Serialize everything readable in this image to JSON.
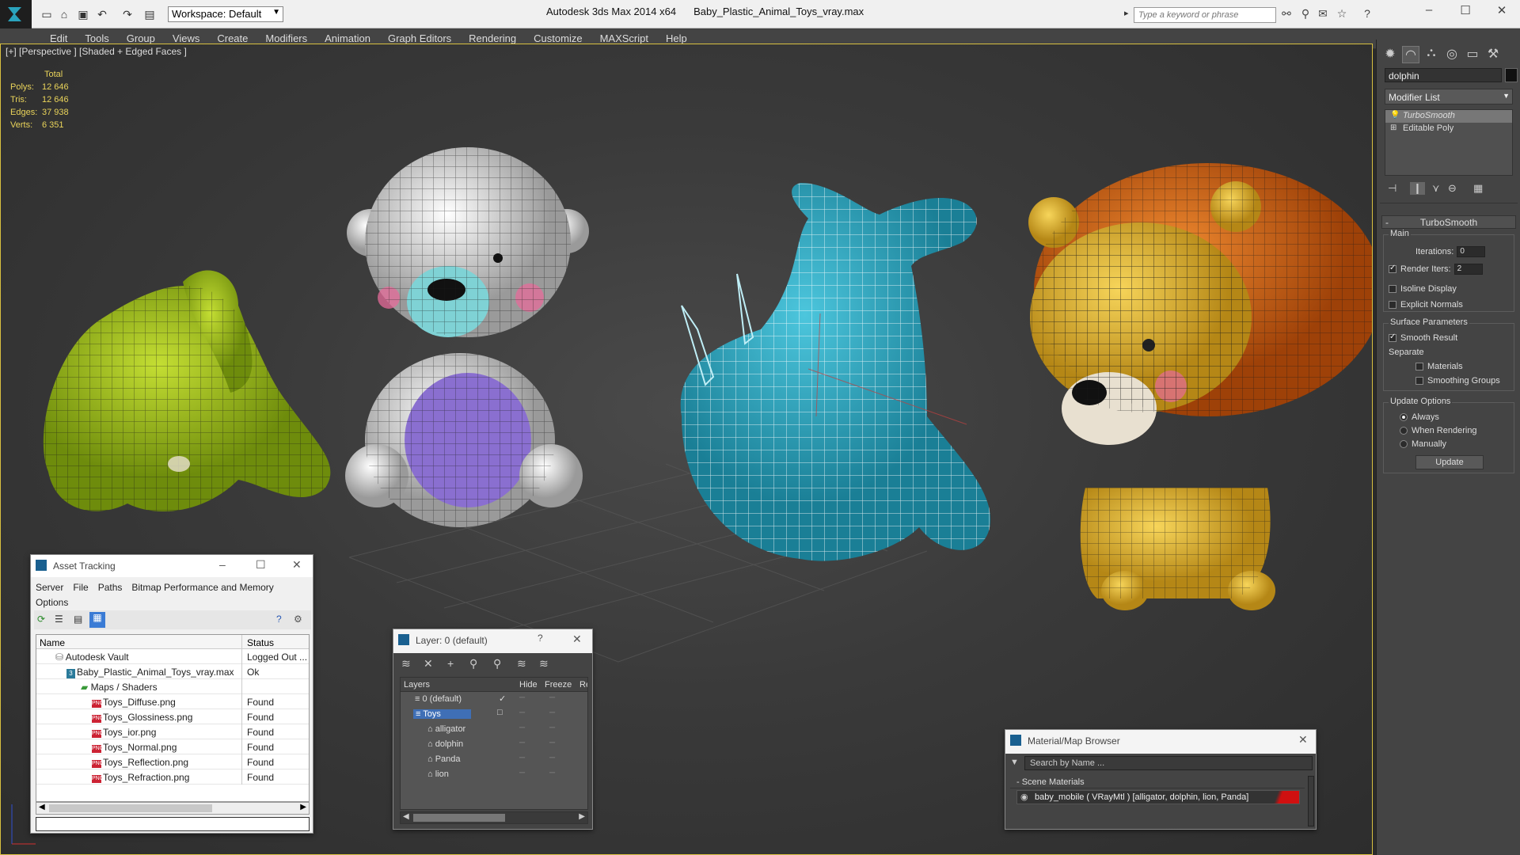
{
  "titlebar": {
    "workspace": "Workspace: Default",
    "app_title": "Autodesk 3ds Max  2014 x64",
    "file_name": "Baby_Plastic_Animal_Toys_vray.max",
    "search_placeholder": "Type a keyword or phrase"
  },
  "menu": [
    "Edit",
    "Tools",
    "Group",
    "Views",
    "Create",
    "Modifiers",
    "Animation",
    "Graph Editors",
    "Rendering",
    "Customize",
    "MAXScript",
    "Help"
  ],
  "viewport": {
    "label": "[+] [Perspective ] [Shaded + Edged Faces ]",
    "stats_header": "Total",
    "stats": [
      {
        "label": "Polys:",
        "value": "12 646"
      },
      {
        "label": "Tris:",
        "value": "12 646"
      },
      {
        "label": "Edges:",
        "value": "37 938"
      },
      {
        "label": "Verts:",
        "value": "6 351"
      }
    ],
    "models": [
      "alligator",
      "Panda",
      "dolphin",
      "lion"
    ]
  },
  "command_panel": {
    "object_name": "dolphin",
    "modifier_list": "Modifier List",
    "stack": [
      "TurboSmooth",
      "Editable Poly"
    ],
    "rollout_title": "TurboSmooth",
    "main_group": "Main",
    "iterations_label": "Iterations:",
    "iterations_value": "0",
    "render_iters_label": "Render Iters:",
    "render_iters_value": "2",
    "render_iters_checked": true,
    "isoline_display": "Isoline Display",
    "explicit_normals": "Explicit Normals",
    "surface_group": "Surface Parameters",
    "smooth_result": "Smooth Result",
    "smooth_result_checked": true,
    "separate": "Separate",
    "materials": "Materials",
    "smoothing_groups": "Smoothing Groups",
    "update_group": "Update Options",
    "update_options": [
      "Always",
      "When Rendering",
      "Manually"
    ],
    "update_selected": "Always",
    "update_button": "Update"
  },
  "asset_tracking": {
    "title": "Asset Tracking",
    "menu": [
      "Server",
      "File",
      "Paths",
      "Bitmap Performance and Memory",
      "Options"
    ],
    "columns": [
      "Name",
      "Status"
    ],
    "rows": [
      {
        "name": "Autodesk Vault",
        "status": "Logged Out ...",
        "level": 1,
        "icon": "vault-icon"
      },
      {
        "name": "Baby_Plastic_Animal_Toys_vray.max",
        "status": "Ok",
        "level": 2,
        "icon": "max-file-icon"
      },
      {
        "name": "Maps / Shaders",
        "status": "",
        "level": 3,
        "icon": "maps-icon"
      },
      {
        "name": "Toys_Diffuse.png",
        "status": "Found",
        "level": 4,
        "icon": "png-icon"
      },
      {
        "name": "Toys_Glossiness.png",
        "status": "Found",
        "level": 4,
        "icon": "png-icon"
      },
      {
        "name": "Toys_ior.png",
        "status": "Found",
        "level": 4,
        "icon": "png-icon"
      },
      {
        "name": "Toys_Normal.png",
        "status": "Found",
        "level": 4,
        "icon": "png-icon"
      },
      {
        "name": "Toys_Reflection.png",
        "status": "Found",
        "level": 4,
        "icon": "png-icon"
      },
      {
        "name": "Toys_Refraction.png",
        "status": "Found",
        "level": 4,
        "icon": "png-icon"
      }
    ]
  },
  "layer_window": {
    "title": "Layer: 0 (default)",
    "help": "?",
    "columns": [
      "Layers",
      "Hide",
      "Freeze",
      "Re"
    ],
    "rows": [
      {
        "name": "0 (default)",
        "level": 0,
        "selected": false,
        "check": "✓"
      },
      {
        "name": "Toys",
        "level": 0,
        "selected": true,
        "check": "□"
      },
      {
        "name": "alligator",
        "level": 1,
        "selected": false,
        "check": ""
      },
      {
        "name": "dolphin",
        "level": 1,
        "selected": false,
        "check": ""
      },
      {
        "name": "Panda",
        "level": 1,
        "selected": false,
        "check": ""
      },
      {
        "name": "lion",
        "level": 1,
        "selected": false,
        "check": ""
      }
    ]
  },
  "material_browser": {
    "title": "Material/Map Browser",
    "search_placeholder": "Search by Name ...",
    "section": "- Scene Materials",
    "item": "baby_mobile  ( VRayMtl ) [alligator, dolphin, lion, Panda]"
  },
  "colors": {
    "viewport_border": "#d8c040",
    "stats_text": "#e9d35a",
    "alligator": "#a7c41a",
    "dolphin": "#2aa3bd",
    "lion_body": "#e8bd3e",
    "lion_mane": "#d96d1b",
    "panda_body": "#e6e6e6",
    "panda_shirt": "#8a6fd0",
    "selection": "#3f6fb6"
  }
}
